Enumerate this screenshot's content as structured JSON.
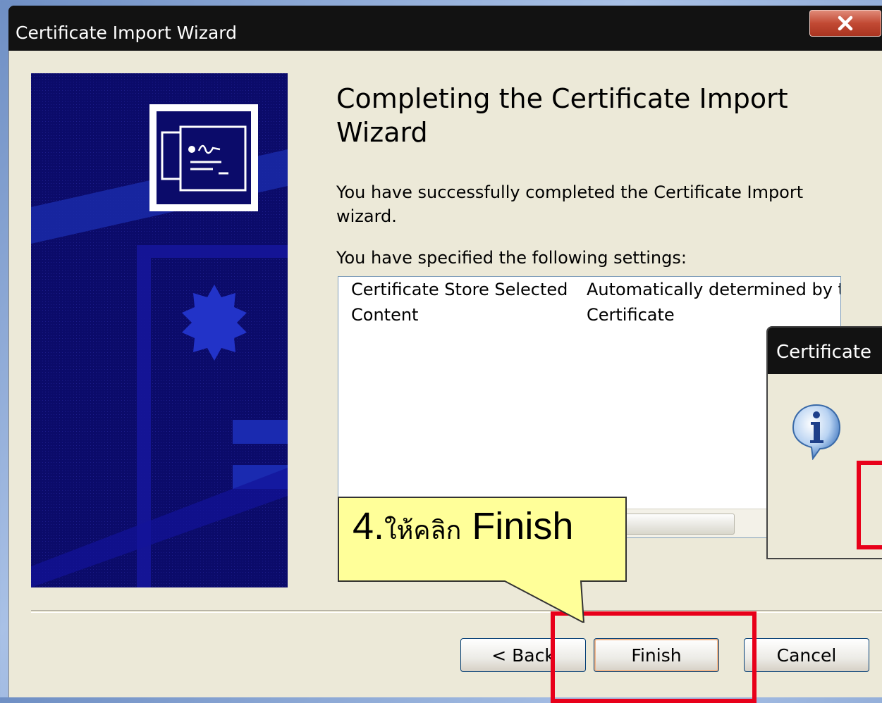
{
  "window": {
    "title": "Certificate Import Wizard",
    "close_label": "x"
  },
  "main": {
    "heading": "Completing the Certificate Import Wizard",
    "description": "You have successfully completed the Certificate Import wizard.",
    "settings_label": "You have specified the following settings:",
    "settings": [
      {
        "key": "Certificate Store Selected",
        "value": "Automatically determined by t"
      },
      {
        "key": "Content",
        "value": "Certificate"
      }
    ]
  },
  "buttons": {
    "back": "< Back",
    "finish": "Finish",
    "cancel": "Cancel"
  },
  "message_box": {
    "title": "Certificate",
    "icon": "info-icon"
  },
  "annotation": {
    "step": "4.",
    "thai_text": "ให้คลิก",
    "action": "Finish",
    "highlight_color": "#e8001a",
    "callout_color": "#ffff99"
  }
}
